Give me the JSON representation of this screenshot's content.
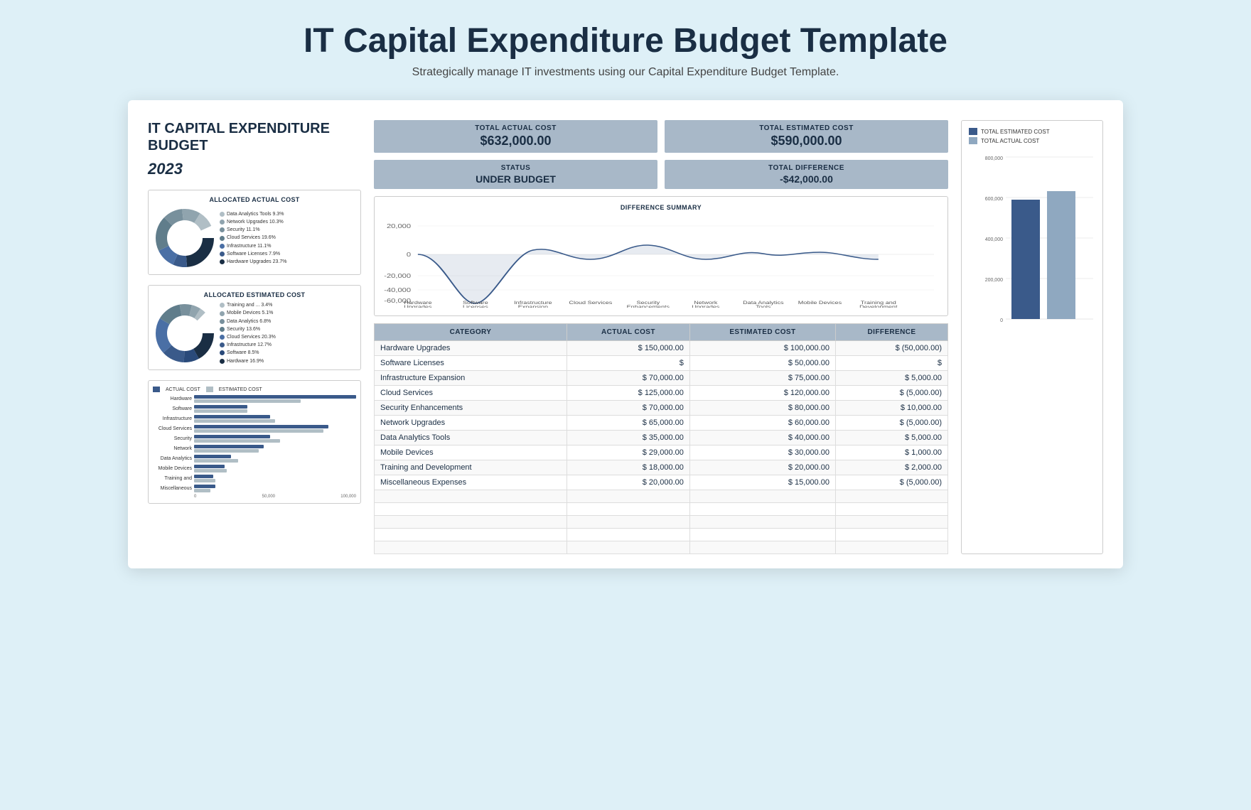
{
  "header": {
    "title": "IT Capital Expenditure Budget Template",
    "subtitle": "Strategically manage IT investments using our Capital Expenditure Budget Template."
  },
  "doc": {
    "title": "IT CAPITAL EXPENDITURE BUDGET",
    "year": "2023"
  },
  "summary": {
    "actual_cost_label": "TOTAL ACTUAL COST",
    "actual_cost_value": "$632,000.00",
    "estimated_cost_label": "TOTAL ESTIMATED COST",
    "estimated_cost_value": "$590,000.00",
    "status_label": "STATUS",
    "status_value": "UNDER BUDGET",
    "difference_label": "TOTAL DIFFERENCE",
    "difference_value": "-$42,000.00"
  },
  "donut1": {
    "title": "ALLOCATED ACTUAL COST",
    "segments": [
      {
        "label": "Data Analytics Tools",
        "value": "9.3%",
        "color": "#b0bec5"
      },
      {
        "label": "Network Upgrades",
        "value": "10.3%",
        "color": "#90a4ae"
      },
      {
        "label": "Security",
        "value": "11.1%",
        "color": "#78909c"
      },
      {
        "label": "Cloud Services",
        "value": "19.6%",
        "color": "#607d8b"
      },
      {
        "label": "Infrastructure",
        "value": "11.1%",
        "color": "#4a6fa5"
      },
      {
        "label": "Software Licenses",
        "value": "7.9%",
        "color": "#3a5a8a"
      },
      {
        "label": "Hardware Upgrades",
        "value": "23.7%",
        "color": "#1a2e44"
      }
    ]
  },
  "donut2": {
    "title": "ALLOCATED ESTIMATED COST",
    "segments": [
      {
        "label": "Training and ...",
        "value": "3.4%",
        "color": "#b0bec5"
      },
      {
        "label": "Mobile Devices",
        "value": "5.1%",
        "color": "#90a4ae"
      },
      {
        "label": "Data Analytics",
        "value": "6.8%",
        "color": "#78909c"
      },
      {
        "label": "Security",
        "value": "13.6%",
        "color": "#607d8b"
      },
      {
        "label": "Cloud Services",
        "value": "20.3%",
        "color": "#4a6fa5"
      },
      {
        "label": "Infrastructure",
        "value": "12.7%",
        "color": "#3a5a8a"
      },
      {
        "label": "Software",
        "value": "8.5%",
        "color": "#2a4a7a"
      },
      {
        "label": "Hardware",
        "value": "16.9%",
        "color": "#1a2e44"
      }
    ]
  },
  "barchart": {
    "legend": [
      {
        "label": "ACTUAL COST",
        "color": "#3a5a8a"
      },
      {
        "label": "ESTIMATED COST",
        "color": "#b0bec5"
      }
    ],
    "rows": [
      {
        "label": "Hardware",
        "actual": 150000,
        "estimated": 100000,
        "maxVal": 150000
      },
      {
        "label": "Software",
        "actual": 50000,
        "estimated": 50000,
        "maxVal": 150000
      },
      {
        "label": "Infrastructure",
        "actual": 70000,
        "estimated": 75000,
        "maxVal": 150000
      },
      {
        "label": "Cloud Services",
        "actual": 125000,
        "estimated": 120000,
        "maxVal": 150000
      },
      {
        "label": "Security",
        "actual": 70000,
        "estimated": 80000,
        "maxVal": 150000
      },
      {
        "label": "Network",
        "actual": 65000,
        "estimated": 60000,
        "maxVal": 150000
      },
      {
        "label": "Data Analytics",
        "actual": 35000,
        "estimated": 40000,
        "maxVal": 150000
      },
      {
        "label": "Mobile Devices",
        "actual": 29000,
        "estimated": 30000,
        "maxVal": 150000
      },
      {
        "label": "Training and",
        "actual": 18000,
        "estimated": 20000,
        "maxVal": 150000
      },
      {
        "label": "Miscellaneous",
        "actual": 20000,
        "estimated": 15000,
        "maxVal": 150000
      }
    ],
    "axis_labels": [
      "0",
      "50,000",
      "100,000"
    ]
  },
  "table": {
    "headers": [
      "CATEGORY",
      "ACTUAL COST",
      "ESTIMATED COST",
      "DIFFERENCE"
    ],
    "rows": [
      {
        "category": "Hardware Upgrades",
        "actual": "$ 150,000.00",
        "estimated": "$ 100,000.00",
        "difference": "$ (50,000.00)"
      },
      {
        "category": "Software Licenses",
        "actual": "$",
        "estimated": "$ 50,000.00",
        "difference": "$"
      },
      {
        "category": "Infrastructure Expansion",
        "actual": "$ 70,000.00",
        "estimated": "$ 75,000.00",
        "difference": "$ 5,000.00"
      },
      {
        "category": "Cloud Services",
        "actual": "$ 125,000.00",
        "estimated": "$ 120,000.00",
        "difference": "$ (5,000.00)"
      },
      {
        "category": "Security Enhancements",
        "actual": "$ 70,000.00",
        "estimated": "$ 80,000.00",
        "difference": "$ 10,000.00"
      },
      {
        "category": "Network Upgrades",
        "actual": "$ 65,000.00",
        "estimated": "$ 60,000.00",
        "difference": "$ (5,000.00)"
      },
      {
        "category": "Data Analytics Tools",
        "actual": "$ 35,000.00",
        "estimated": "$ 40,000.00",
        "difference": "$ 5,000.00"
      },
      {
        "category": "Mobile Devices",
        "actual": "$ 29,000.00",
        "estimated": "$ 30,000.00",
        "difference": "$ 1,000.00"
      },
      {
        "category": "Training and Development",
        "actual": "$ 18,000.00",
        "estimated": "$ 20,000.00",
        "difference": "$ 2,000.00"
      },
      {
        "category": "Miscellaneous Expenses",
        "actual": "$ 20,000.00",
        "estimated": "$ 15,000.00",
        "difference": "$ (5,000.00)"
      }
    ]
  },
  "compare_chart": {
    "legend": [
      {
        "label": "TOTAL ESTIMATED COST",
        "color": "#3a5a8a"
      },
      {
        "label": "TOTAL ACTUAL COST",
        "color": "#8fa8c0"
      }
    ],
    "bars": [
      {
        "label": "",
        "estimated": 590000,
        "actual": 632000
      }
    ],
    "y_labels": [
      "800,000",
      "600,000",
      "400,000",
      "200,000",
      "0"
    ],
    "max": 800000
  }
}
